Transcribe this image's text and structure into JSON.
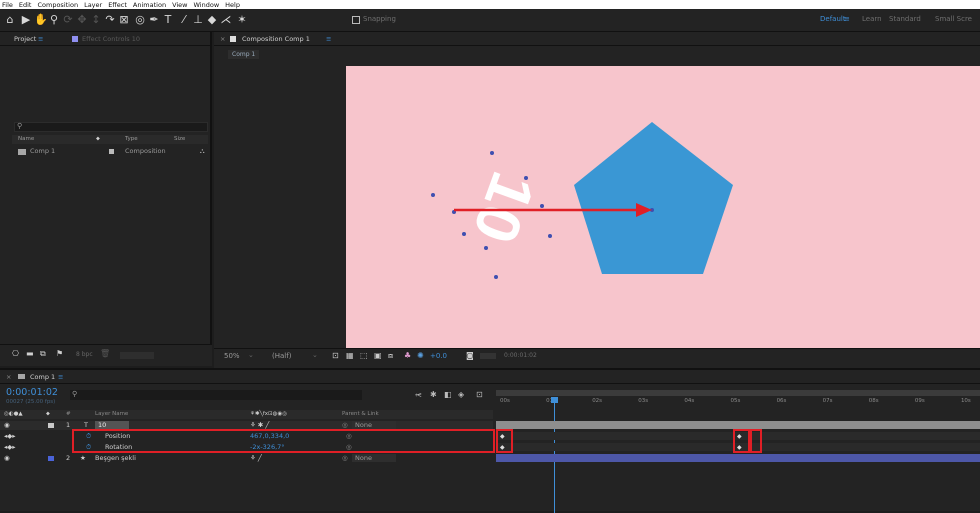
{
  "menu": [
    "File",
    "Edit",
    "Composition",
    "Layer",
    "Effect",
    "Animation",
    "View",
    "Window",
    "Help"
  ],
  "toolbar": {
    "snapping_label": "Snapping",
    "workspaces": [
      "Default",
      "Learn",
      "Standard",
      "Small Scre"
    ]
  },
  "project_panel": {
    "tab_project": "Project",
    "tab_effect_controls": "Effect Controls 10",
    "columns": [
      "Name",
      "Type",
      "Size"
    ],
    "items": [
      {
        "name": "Comp 1",
        "type": "Composition"
      }
    ],
    "bpc": "8 bpc"
  },
  "composition_panel": {
    "tab_label": "Composition Comp 1",
    "breadcrumb": "Comp 1",
    "zoom": "50%",
    "resolution": "(Half)",
    "exposure": "+0.0",
    "timecode": "0:00:01:02"
  },
  "canvas": {
    "background_color": "#f7c5cc",
    "pentagon_color": "#3a97d4",
    "arrow_color": "#e01f26",
    "text_layer_content": "10"
  },
  "timeline": {
    "tab_label": "Comp 1",
    "timecode": "0:00:01:02",
    "fps_info": "00027 (25.00 fps)",
    "columns": {
      "layer_name": "Layer Name",
      "parent": "Parent & Link"
    },
    "layers": [
      {
        "index": "1",
        "name": "10",
        "parent": "None"
      },
      {
        "index": "2",
        "name": "Beşgen şekli",
        "parent": "None"
      }
    ],
    "properties": [
      {
        "name": "Position",
        "value": "467,0,334,0"
      },
      {
        "name": "Rotation",
        "value": "-2x-326,7°"
      }
    ],
    "ruler": [
      "00s",
      "01s",
      "02s",
      "03s",
      "04s",
      "05s",
      "06s",
      "07s",
      "08s",
      "09s",
      "10s"
    ],
    "highlight_color": "#e01f26"
  }
}
